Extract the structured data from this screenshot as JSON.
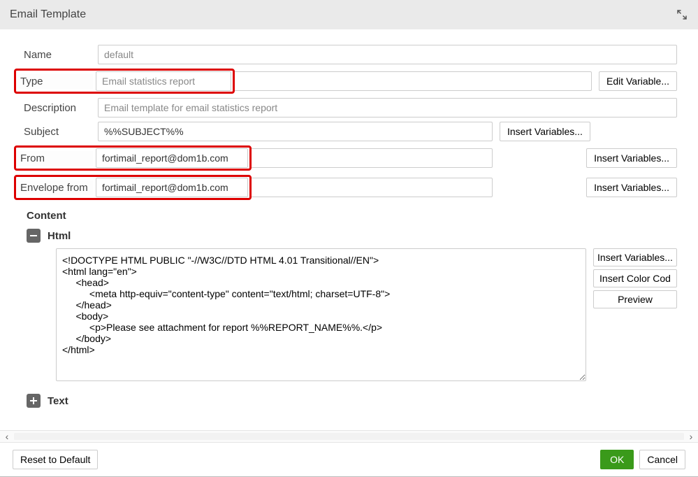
{
  "header": {
    "title": "Email Template"
  },
  "labels": {
    "name": "Name",
    "type": "Type",
    "description": "Description",
    "subject": "Subject",
    "from": "From",
    "envelope_from": "Envelope from",
    "content": "Content",
    "html": "Html",
    "text": "Text"
  },
  "fields": {
    "name": "default",
    "type": "Email statistics report",
    "description": "Email template for email statistics report",
    "subject": "%%SUBJECT%%",
    "from": "fortimail_report@dom1b.com",
    "envelope_from": "fortimail_report@dom1b.com"
  },
  "buttons": {
    "edit_variable": "Edit Variable...",
    "insert_variables": "Insert Variables...",
    "insert_color_code": "Insert Color Cod",
    "preview": "Preview",
    "reset": "Reset to Default",
    "ok": "OK",
    "cancel": "Cancel"
  },
  "html_content": "<!DOCTYPE HTML PUBLIC \"-//W3C//DTD HTML 4.01 Transitional//EN\">\n<html lang=\"en\">\n     <head>\n          <meta http-equiv=\"content-type\" content=\"text/html; charset=UTF-8\">\n     </head>\n     <body>\n          <p>Please see attachment for report %%REPORT_NAME%%.</p>\n     </body>\n</html>"
}
